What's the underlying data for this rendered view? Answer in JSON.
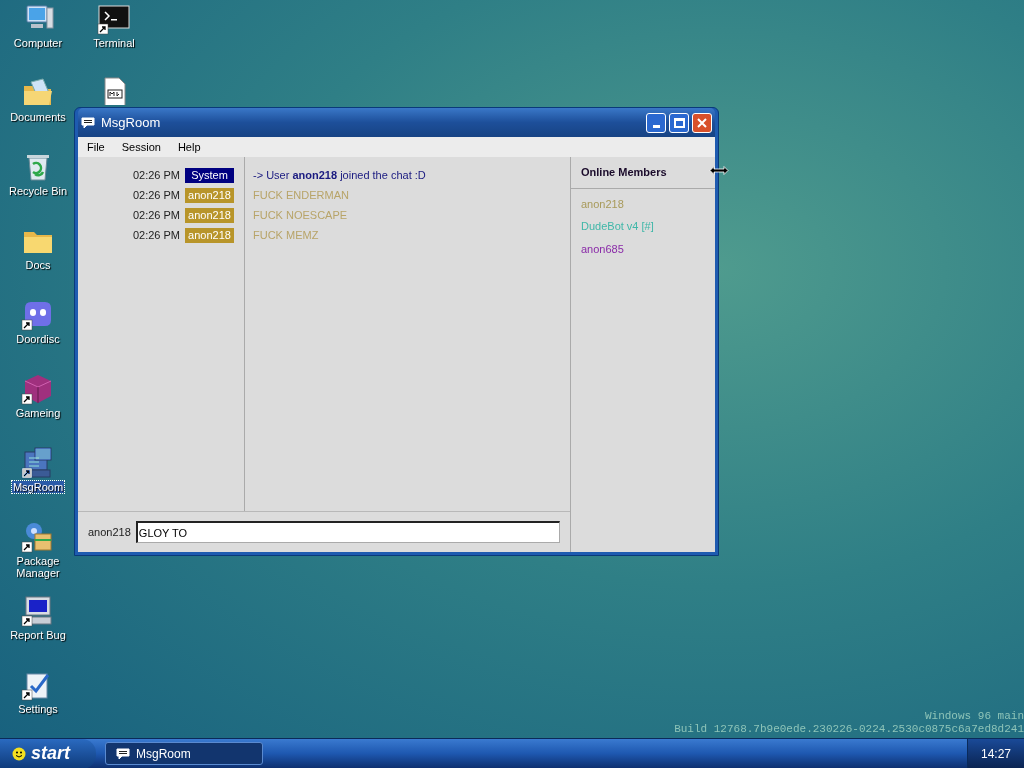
{
  "desktop_columns": [
    {
      "icons": [
        {
          "kind": "computer",
          "label": "Computer",
          "shortcut": false,
          "selected": false
        },
        {
          "kind": "documents",
          "label": "Documents",
          "shortcut": false,
          "selected": false
        },
        {
          "kind": "recycle",
          "label": "Recycle Bin",
          "shortcut": false,
          "selected": false
        },
        {
          "kind": "folder",
          "label": "Docs",
          "shortcut": false,
          "selected": false
        },
        {
          "kind": "chat",
          "label": "Doordisc",
          "shortcut": true,
          "selected": false
        },
        {
          "kind": "cube",
          "label": "Gameing",
          "shortcut": true,
          "selected": false
        },
        {
          "kind": "msgroom",
          "label": "MsgRoom",
          "shortcut": true,
          "selected": true
        },
        {
          "kind": "package",
          "label": "Package Manager",
          "shortcut": true,
          "selected": false
        },
        {
          "kind": "monitor",
          "label": "Report Bug",
          "shortcut": true,
          "selected": false
        },
        {
          "kind": "settings",
          "label": "Settings",
          "shortcut": true,
          "selected": false
        }
      ]
    },
    {
      "icons": [
        {
          "kind": "terminal",
          "label": "Terminal",
          "shortcut": true,
          "selected": false
        },
        {
          "kind": "file",
          "shortcut": false,
          "selected": false
        }
      ]
    }
  ],
  "window": {
    "title": "MsgRoom",
    "menu": [
      "File",
      "Session",
      "Help"
    ],
    "messages": [
      {
        "time": "02:26 PM",
        "sender": {
          "name": "System",
          "color": "#000080"
        },
        "text": "-> User **anon218** joined the chat :D",
        "color": "#1a1a80"
      },
      {
        "time": "02:26 PM",
        "sender": {
          "name": "anon218",
          "color": "#b8952a"
        },
        "text": "FUCK ENDERMAN",
        "color": "#b8a468"
      },
      {
        "time": "02:26 PM",
        "sender": {
          "name": "anon218",
          "color": "#b8952a"
        },
        "text": "FUCK NOESCAPE",
        "color": "#b8a468"
      },
      {
        "time": "02:26 PM",
        "sender": {
          "name": "anon218",
          "color": "#b8952a"
        },
        "text": "FUCK MEMZ",
        "color": "#b8a468"
      }
    ],
    "members_title": "Online Members",
    "members": [
      {
        "name": "anon218",
        "color": "#a89a5a"
      },
      {
        "name": "DudeBot v4 [#]",
        "color": "#3fb7a8"
      },
      {
        "name": "anon685",
        "color": "#8a2ba8"
      }
    ],
    "input_label": "anon218",
    "input_value": "GLOY TO"
  },
  "build_info": [
    "Windows 96 main",
    "Build 12768.7b9e0ede.230226-0224.2530c0875c6a7ed8d241"
  ],
  "taskbar": {
    "start": "start",
    "tasks": [
      {
        "label": "MsgRoom",
        "selected": false
      }
    ],
    "clock": "14:27"
  }
}
